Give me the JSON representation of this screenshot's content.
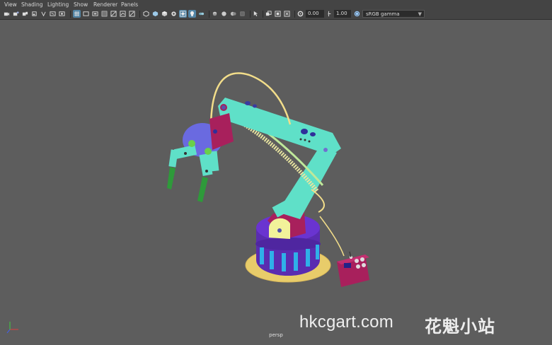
{
  "menu": [
    "View",
    "Shading",
    "Lighting",
    "Show",
    "Renderer",
    "Panels"
  ],
  "toolbar": {
    "exposure_value": "0.00",
    "gamma_value": "1.00",
    "color_space": "sRGB gamma",
    "icons": [
      "camera-select-icon",
      "camera-attributes-icon",
      "bookmark-icon",
      "image-plane-icon",
      "grid-icon",
      "film-gate-icon",
      "resolution-gate-icon",
      "gate-mask-icon",
      "field-chart-icon",
      "safe-action-icon",
      "safe-title-icon",
      "wireframe-icon",
      "smooth-shade-icon",
      "use-default-material-icon",
      "wireframe-on-shaded-icon",
      "xray-icon",
      "xray-joints-icon",
      "backface-culling-icon",
      "default-lighting-icon",
      "shadows-icon",
      "screen-space-ao-icon",
      "motion-blur-icon",
      "antialias-icon",
      "depth-of-field-icon",
      "isolate-select-icon",
      "xray-active-icon",
      "exposure-icon",
      "gamma-icon"
    ]
  },
  "viewport": {
    "camera": "persp",
    "watermark_latin": "hkcgart.com",
    "watermark_cjk": "花魁小站"
  },
  "colors": {
    "background": "#5d5d5d",
    "arm_teal": "#5fe0c8",
    "base_purple": "#6a2fc2",
    "accent_magenta": "#a8205c",
    "cable_yellow": "#f2dd8a",
    "ring_yellow": "#e8cc6a",
    "pillar_blue": "#2fb0e8",
    "gripper_green": "#2e9a3a",
    "motor_blue": "#6a6ae0",
    "highlight": "#5285a6"
  }
}
